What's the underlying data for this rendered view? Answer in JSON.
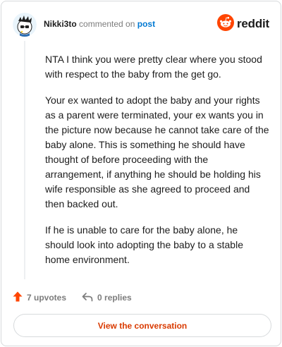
{
  "comment": {
    "author": "Nikki3to",
    "action_text": "commented on",
    "target_link": "post"
  },
  "brand": {
    "name": "reddit",
    "accent_color": "#ff4500"
  },
  "body": {
    "paragraphs": [
      "NTA I think you were pretty clear where you stood with respect to the baby from the get go.",
      "Your ex wanted to adopt the baby and your rights as a parent were terminated, your ex wants you in the picture now because he cannot take care of the baby alone. This is something he should have thought of before proceeding with the arrangement, if anything he should be holding his wife responsible as she agreed to proceed and then backed out.",
      "If he is unable to care for the baby alone, he should look into adopting the baby to a stable home environment."
    ]
  },
  "footer": {
    "upvotes_label": "7 upvotes",
    "replies_label": "0 replies",
    "cta_label": "View the conversation"
  },
  "icons": {
    "upvote": "upvote-arrow-icon",
    "reply": "reply-arrow-icon",
    "brand": "reddit-snoo-icon"
  }
}
